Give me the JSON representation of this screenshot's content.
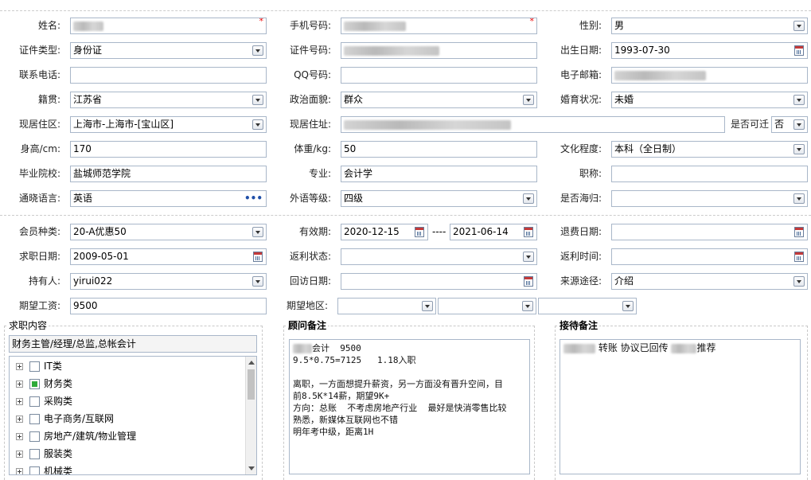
{
  "personal": {
    "name_label": "姓名:",
    "name_req": "*",
    "phone_label": "手机号码:",
    "phone_req": "*",
    "gender_label": "性别:",
    "gender_value": "男",
    "id_type_label": "证件类型:",
    "id_type_value": "身份证",
    "id_no_label": "证件号码:",
    "birth_label": "出生日期:",
    "birth_value": "1993-07-30",
    "tel_label": "联系电话:",
    "qq_label": "QQ号码:",
    "email_label": "电子邮箱:",
    "native_label": "籍贯:",
    "native_value": "江苏省",
    "political_label": "政治面貌:",
    "political_value": "群众",
    "marital_label": "婚育状况:",
    "marital_value": "未婚",
    "area_label": "现居住区:",
    "area_value": "上海市-上海市-[宝山区]",
    "address_label": "现居住址:",
    "relocate_label": "是否可迁",
    "relocate_value": "否",
    "height_label": "身高/cm:",
    "height_value": "170",
    "weight_label": "体重/kg:",
    "weight_value": "50",
    "edu_label": "文化程度:",
    "edu_value": "本科（全日制）",
    "school_label": "毕业院校:",
    "school_value": "盐城师范学院",
    "major_label": "专业:",
    "major_value": "会计学",
    "title_label": "职称:",
    "lang_label": "通晓语言:",
    "lang_value": "英语",
    "level_label": "外语等级:",
    "level_value": "四级",
    "overseas_label": "是否海归:"
  },
  "member": {
    "type_label": "会员种类:",
    "type_value": "20-A优惠50",
    "valid_label": "有效期:",
    "valid_from": "2020-12-15",
    "valid_sep": "----",
    "valid_to": "2021-06-14",
    "refund_label": "退费日期:",
    "jobdate_label": "求职日期:",
    "jobdate_value": "2009-05-01",
    "rebate_label": "返利状态:",
    "rebate_time_label": "返利时间:",
    "holder_label": "持有人:",
    "holder_value": "yirui022",
    "visit_label": "回访日期:",
    "source_label": "来源途径:",
    "source_value": "介绍",
    "salary_label": "期望工资:",
    "salary_value": "9500",
    "region_label": "期望地区:"
  },
  "job": {
    "title": "求职内容",
    "summary": "财务主管/经理/总监,总帐会计",
    "items": [
      {
        "label": "IT类",
        "checked": false
      },
      {
        "label": "财务类",
        "checked": true
      },
      {
        "label": "采购类",
        "checked": false
      },
      {
        "label": "电子商务/互联网",
        "checked": false
      },
      {
        "label": "房地产/建筑/物业管理",
        "checked": false
      },
      {
        "label": "服装类",
        "checked": false
      },
      {
        "label": "机械类",
        "checked": false
      }
    ]
  },
  "consultant": {
    "title": "顾问备注",
    "line1": "会计  9500",
    "line2": "9.5*0.75=7125   1.18入职",
    "line3": "",
    "line4": "离职，一方面想提升薪资，另一方面没有晋升空间，目",
    "line5": "前8.5K*14薪，期望9K+",
    "line6": "方向：总账  不考虑房地产行业  最好是快消零售比较",
    "line7": "熟悉，新媒体互联网也不错",
    "line8": "明年考中级，距离1H"
  },
  "reception": {
    "title": "接待备注",
    "part1": "转账 协议已回传",
    "part2": "推荐"
  }
}
